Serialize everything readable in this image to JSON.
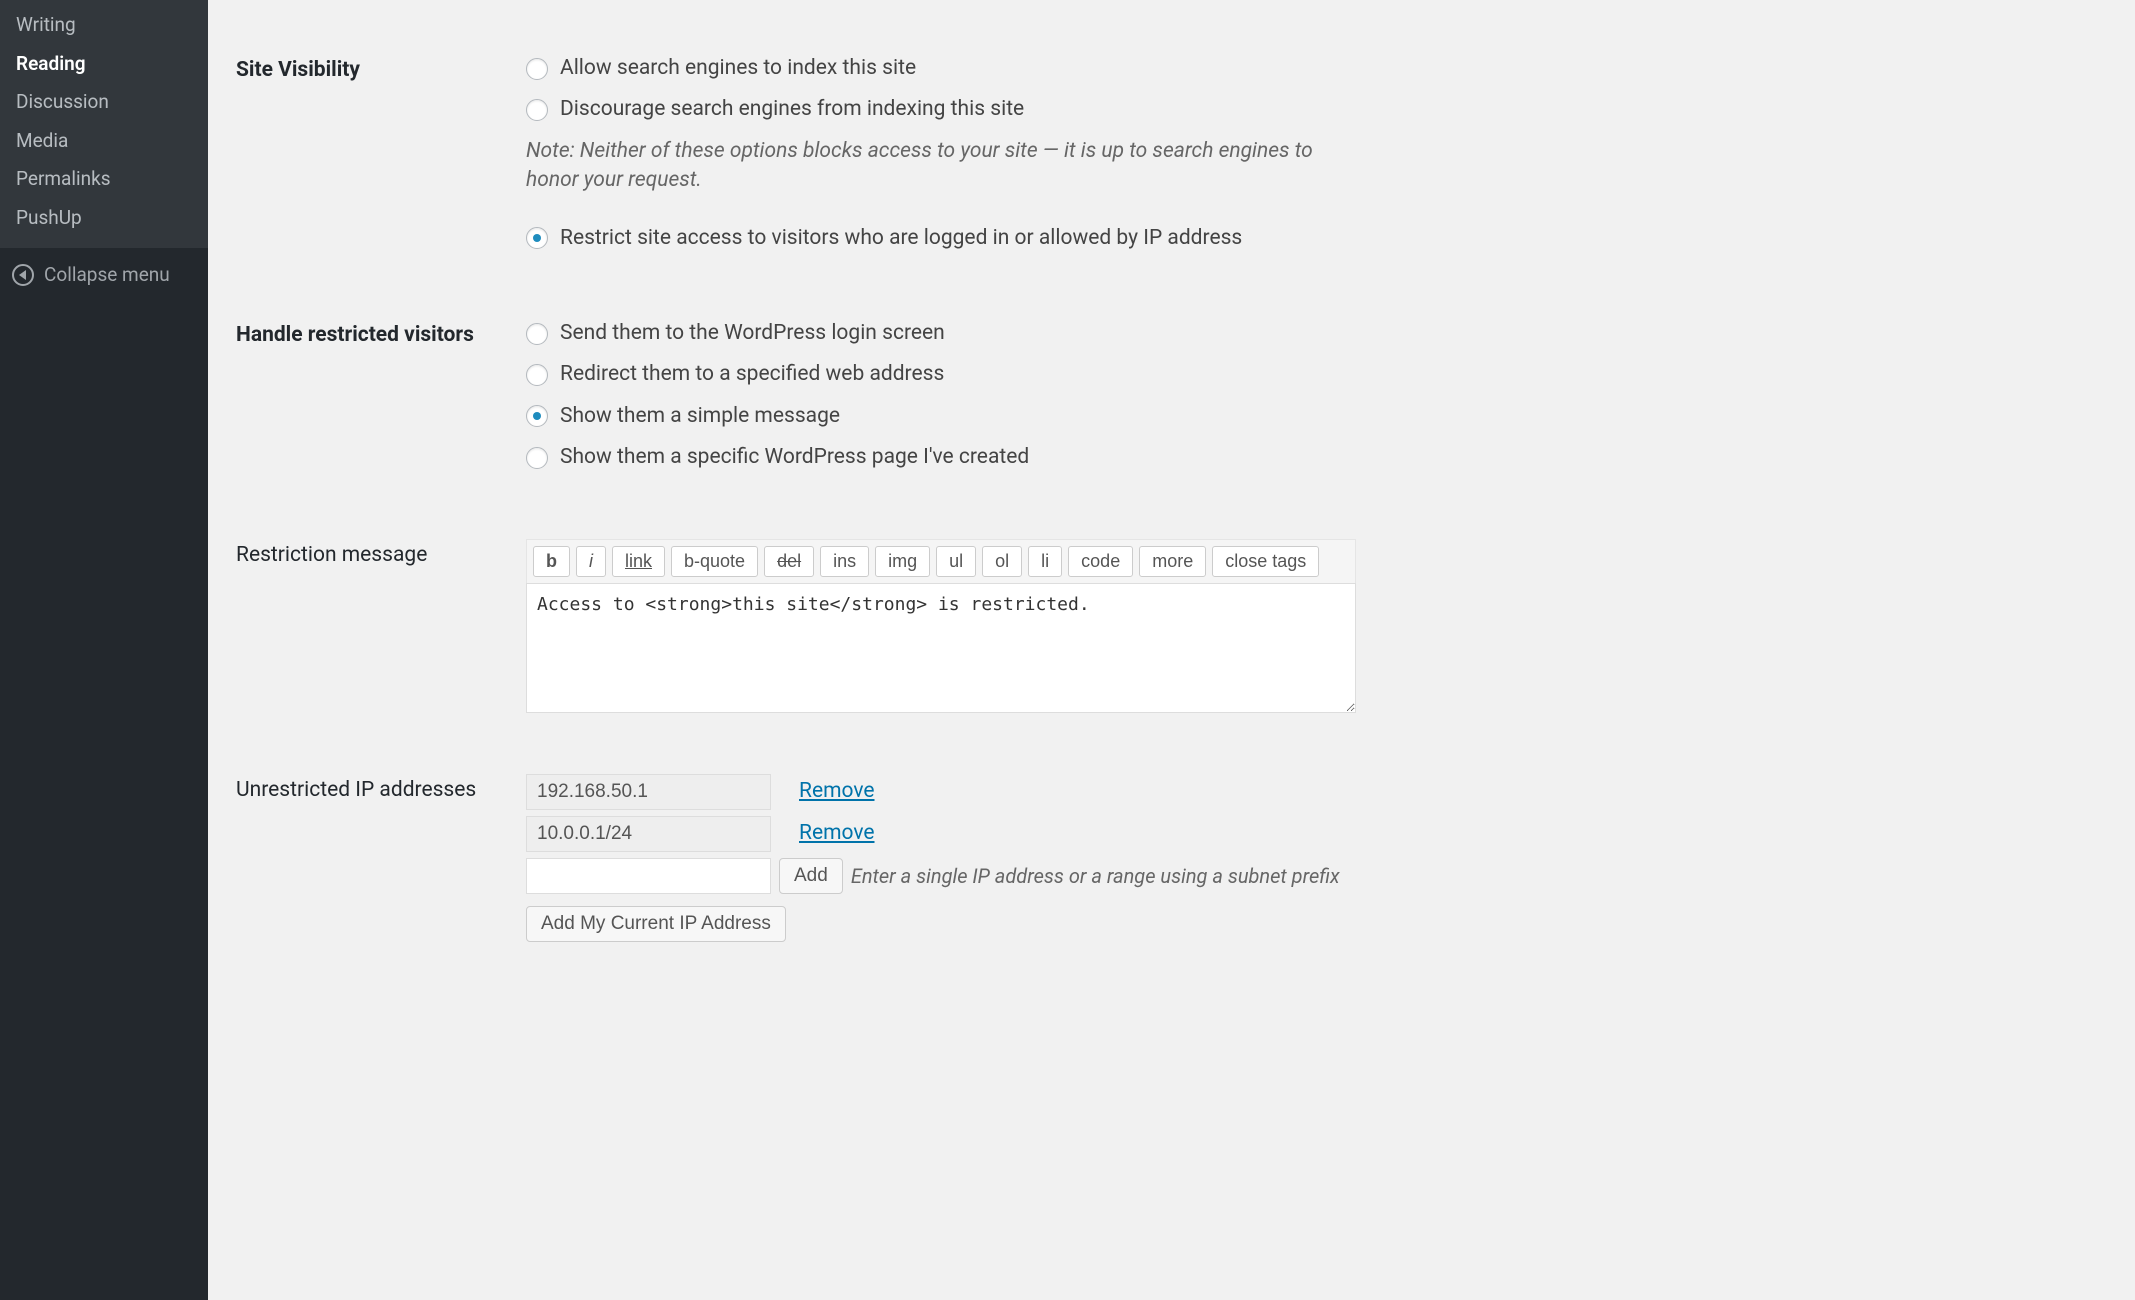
{
  "sidebar": {
    "submenu": [
      {
        "label": "Writing",
        "active": false
      },
      {
        "label": "Reading",
        "active": true
      },
      {
        "label": "Discussion",
        "active": false
      },
      {
        "label": "Media",
        "active": false
      },
      {
        "label": "Permalinks",
        "active": false
      },
      {
        "label": "PushUp",
        "active": false
      }
    ],
    "collapse_label": "Collapse menu"
  },
  "site_visibility": {
    "heading": "Site Visibility",
    "options": [
      {
        "label": "Allow search engines to index this site",
        "checked": false
      },
      {
        "label": "Discourage search engines from indexing this site",
        "checked": false
      }
    ],
    "note": "Note: Neither of these options blocks access to your site — it is up to search engines to honor your request.",
    "restrict_option": {
      "label": "Restrict site access to visitors who are logged in or allowed by IP address",
      "checked": true
    }
  },
  "restricted": {
    "heading": "Handle restricted visitors",
    "options": [
      {
        "label": "Send them to the WordPress login screen",
        "checked": false
      },
      {
        "label": "Redirect them to a specified web address",
        "checked": false
      },
      {
        "label": "Show them a simple message",
        "checked": true
      },
      {
        "label": "Show them a specific WordPress page I've created",
        "checked": false
      }
    ]
  },
  "message": {
    "heading": "Restriction message",
    "quicktags": [
      {
        "label": "b",
        "style": "bold"
      },
      {
        "label": "i",
        "style": "italic"
      },
      {
        "label": "link",
        "style": "link-btn"
      },
      {
        "label": "b-quote",
        "style": ""
      },
      {
        "label": "del",
        "style": "del-btn"
      },
      {
        "label": "ins",
        "style": ""
      },
      {
        "label": "img",
        "style": ""
      },
      {
        "label": "ul",
        "style": ""
      },
      {
        "label": "ol",
        "style": ""
      },
      {
        "label": "li",
        "style": ""
      },
      {
        "label": "code",
        "style": ""
      },
      {
        "label": "more",
        "style": ""
      },
      {
        "label": "close tags",
        "style": ""
      }
    ],
    "value": "Access to <strong>this site</strong> is restricted."
  },
  "ip": {
    "heading": "Unrestricted IP addresses",
    "rows": [
      {
        "value": "192.168.50.1",
        "remove": "Remove"
      },
      {
        "value": "10.0.0.1/24",
        "remove": "Remove"
      }
    ],
    "add_label": "Add",
    "hint": "Enter a single IP address or a range using a subnet prefix",
    "current_ip_label": "Add My Current IP Address"
  }
}
